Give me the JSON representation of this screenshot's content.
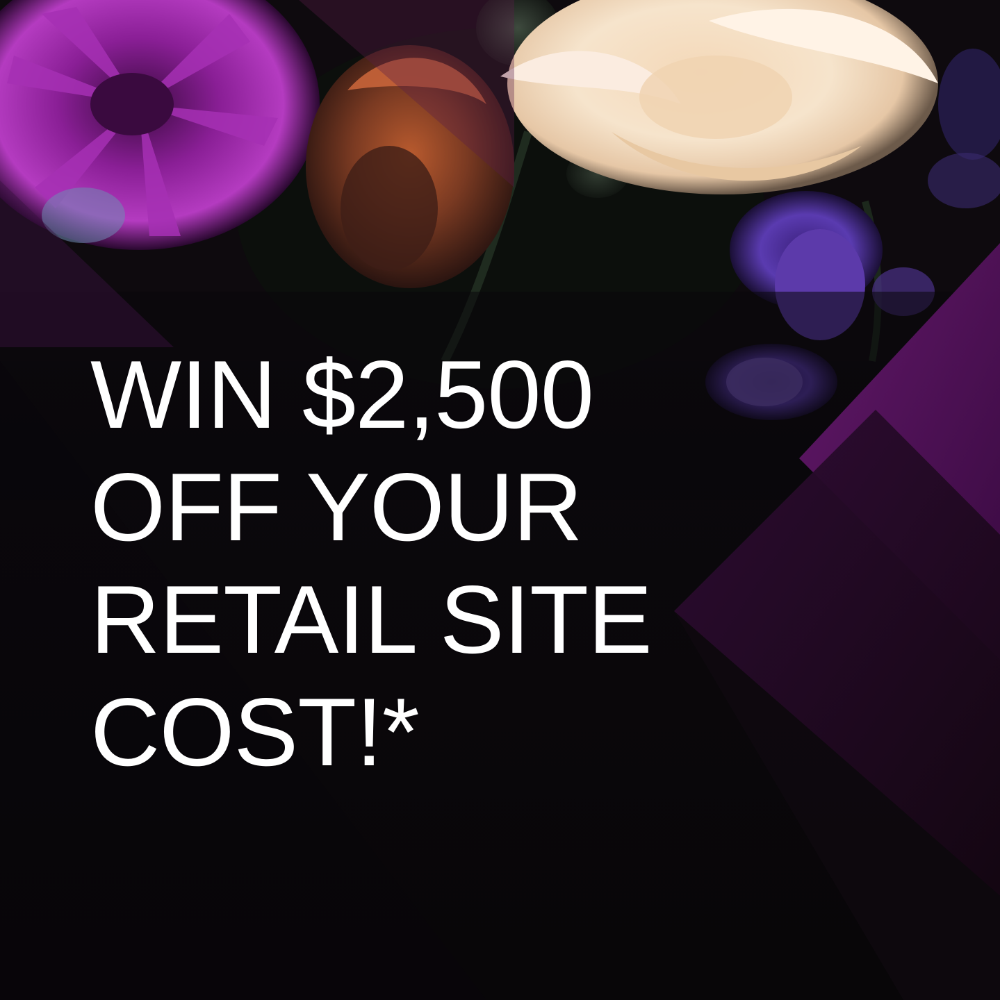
{
  "promo": {
    "headline_lines": [
      "WIN $2,500",
      "OFF YOUR",
      "RETAIL SITE",
      "COST!*"
    ]
  },
  "colors": {
    "background": "#0a070b",
    "accent_purple": "#5b1463",
    "deep_purple": "#2a0d2e",
    "text": "#ffffff"
  },
  "imagery": {
    "icons": [
      "purple-dahlia",
      "peach-rose",
      "orange-tulip",
      "violet-larkspur"
    ]
  }
}
